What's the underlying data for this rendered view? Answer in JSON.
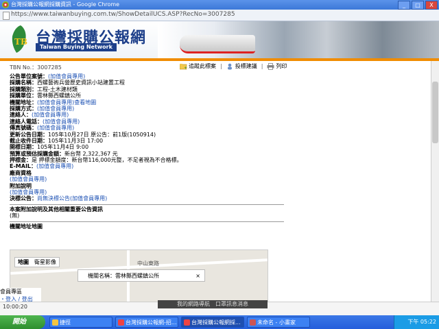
{
  "window": {
    "title": "台灣採購公報網採購資訊 - Google Chrome",
    "controls": [
      "_",
      "□",
      "X"
    ]
  },
  "urlbar": {
    "url": "https://www.taiwanbuying.com.tw/ShowDetailUCS.ASP?RecNo=3007285"
  },
  "banner": {
    "logo_cn": "台灣採購公報網",
    "logo_en": "Taiwan Buying Network"
  },
  "tender": {
    "number": "TBN No.：3007285"
  },
  "tools": {
    "add_favorite": "追蹤此標案",
    "suggest": "投標建議",
    "print": "列印",
    "sep": "|"
  },
  "fields": [
    {
      "label": "公告單位案號：",
      "value": "(加值會員專用)",
      "link": true
    },
    {
      "label": "採購名稱：",
      "value": "西螺藝術兵營歷史資訊小站建置工程",
      "link": false
    },
    {
      "label": "採購類別：",
      "value": "工程-土木建材類",
      "link": false
    },
    {
      "label": "採購單位：",
      "value": "雲林縣西螺鎮公所",
      "link": false
    },
    {
      "label": "機關地址：",
      "value": "(加值會員專用)查看地圖",
      "link": true
    },
    {
      "label": "採購方式：",
      "value": "(加值會員專用)",
      "link": true
    },
    {
      "label": "連絡人：",
      "value": "(加值會員專用)",
      "link": true
    },
    {
      "label": "連絡人電話：",
      "value": "(加值會員專用)",
      "link": true
    },
    {
      "label": "傳真號碼：",
      "value": "(加值會員專用)",
      "link": true
    },
    {
      "label": "更新公告日期：",
      "value": "105年10月27日 原公告：前1版(1050914)",
      "link": false
    },
    {
      "label": "截止收件日期：",
      "value": "105年11月3日 17:00",
      "link": false
    },
    {
      "label": "開標日期：",
      "value": "105年11月4日 9:00",
      "link": false
    },
    {
      "label": "預算或預估採購金額：",
      "value": "新台幣 2,322,367 元",
      "link": false
    },
    {
      "label": "押標金：",
      "value": "是 押標金額度：新台幣116,000元整，不足者視為不合格標。",
      "link": false
    },
    {
      "label": "E-MAIL：",
      "value": "(加值會員專用)",
      "link": true
    },
    {
      "label": "廠商資格",
      "value": "",
      "link": false
    },
    {
      "label": "",
      "value": "(加值會員專用)",
      "link": true
    },
    {
      "label": "附加說明",
      "value": "",
      "link": false
    },
    {
      "label": "",
      "value": "(加值會員專用)",
      "link": true
    },
    {
      "label": "決標公告：",
      "value": "尚無決標公告(加值會員專用)",
      "link": true
    }
  ],
  "related": {
    "heading": "本案附加說明及其他相關重要公告資訊",
    "value": "(無)"
  },
  "map": {
    "heading": "機關地址地圖",
    "tab_map": "地圖",
    "tab_sat": "衛星影像",
    "road": "中山東路",
    "info": "機關名稱：雲林縣西螺鎮公所",
    "close": "×"
  },
  "member": {
    "title": "會員專區",
    "login": "・登入 / 登出"
  },
  "caption": "我的網路導航　口罩訊息消息",
  "status": {
    "left": "10:00:20"
  },
  "taskbar": {
    "start": "開始",
    "tasks": [
      "捷徑",
      "台灣採購公報網-招...",
      "台灣採購公報網採...",
      "未命名 - 小畫家"
    ],
    "clock": "下午 05:22"
  }
}
